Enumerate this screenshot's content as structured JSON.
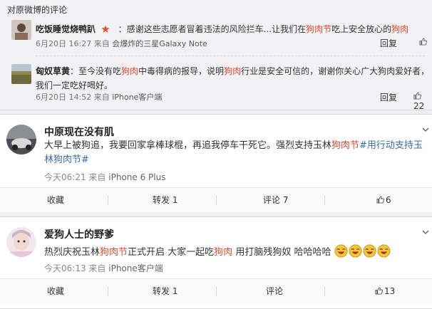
{
  "orig_section": {
    "header": "对原微博的评论",
    "comments": [
      {
        "user": "吃饭睡觉烧鸭趴",
        "text_prefix": "：感谢这些志愿者冒着违法的风险拦车...让我们在",
        "kw1": "狗肉节",
        "text_mid": "吃上安全放心的",
        "kw2": "狗肉",
        "date": "6月20日 16:27",
        "from": "来自",
        "source": "会爆炸的三星Galaxy Note",
        "reply": "回复",
        "likes": ""
      },
      {
        "user": "匈奴草黄",
        "text_a": "：至今没有吃",
        "kw1": "狗肉",
        "text_b": "中毒得病的报导，说明",
        "kw2": "狗肉",
        "text_c": "行业是安全可信的，谢谢你关心广大狗肉爱好者，我们一定吃好喝好。",
        "date": "6月20日 14:52",
        "from": "来自",
        "source": "iPhone客户端",
        "reply": "回复",
        "likes": "22"
      }
    ]
  },
  "posts": [
    {
      "user": "中原现在没有肌",
      "text_a": "大早上被狗追，我要回家拿棒球棍，再追我停车干死它。强烈支持玉林",
      "kw": "狗肉节",
      "topic": "#用行动支持玉林狗肉节#",
      "time": "今天06:21",
      "from": "来自",
      "source": "iPhone 6 Plus",
      "actions": {
        "fav": "收藏",
        "repost": "转发 1",
        "comment": "评论 7",
        "like": "6"
      }
    },
    {
      "user": "爱狗人士的野爹",
      "text_a": "热烈庆祝玉林",
      "kw1": "狗肉节",
      "text_b": "正式开启 大家一起吃",
      "kw2": "狗肉",
      "text_c": " 用打脑残狗奴 哈哈哈哈",
      "time": "今天06:13",
      "from": "来自",
      "source": "iPhone客户端",
      "actions": {
        "fav": "收藏",
        "repost": "转发 1",
        "comment": "评论",
        "like": "13"
      }
    }
  ],
  "colors": {
    "keyword": "#e5482b",
    "link": "#3a6ea5"
  }
}
